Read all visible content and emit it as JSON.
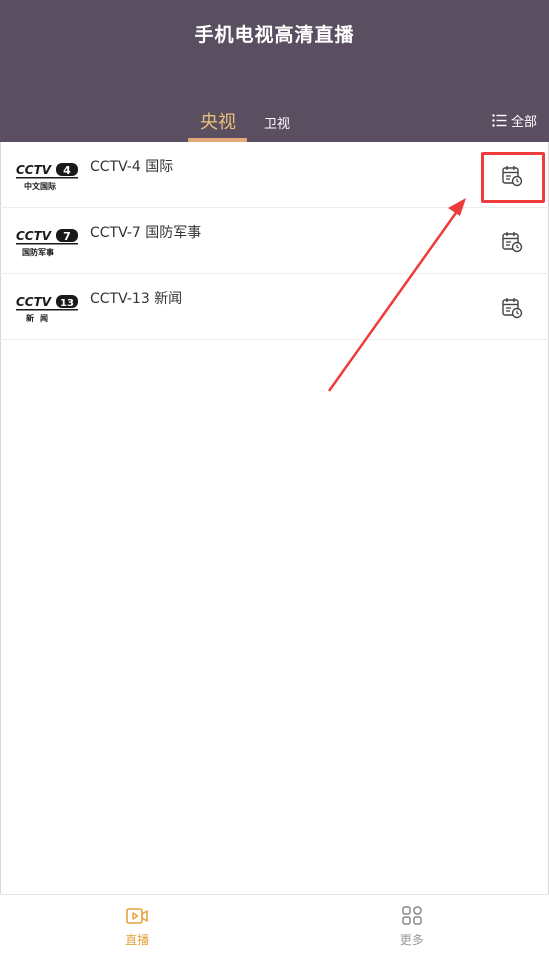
{
  "header": {
    "title": "手机电视高清直播",
    "tabs": [
      {
        "label": "央视",
        "active": true
      },
      {
        "label": "卫视",
        "active": false
      }
    ],
    "all_label": "全部"
  },
  "channels": [
    {
      "name": "CCTV-4 国际",
      "logo_num": "4",
      "logo_sub": "中文国际"
    },
    {
      "name": "CCTV-7 国防军事",
      "logo_num": "7",
      "logo_sub": "国防军事"
    },
    {
      "name": "CCTV-13 新闻",
      "logo_num": "13",
      "logo_sub": "新闻"
    }
  ],
  "bottom_nav": [
    {
      "label": "直播",
      "active": true
    },
    {
      "label": "更多",
      "active": false
    }
  ],
  "colors": {
    "header_bg": "#5a4e61",
    "accent": "#e6c07a",
    "nav_active": "#e6a23c",
    "highlight": "#ee3b3b"
  }
}
